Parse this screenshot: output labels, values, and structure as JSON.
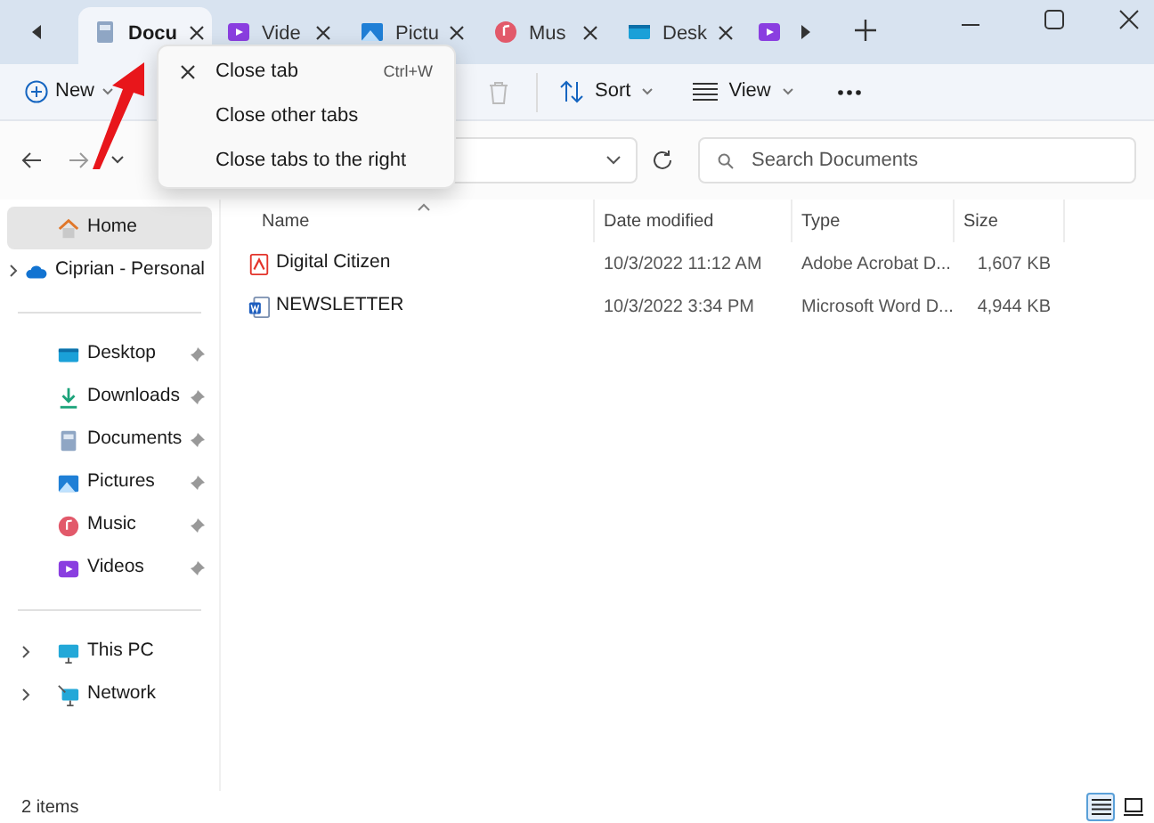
{
  "tabs": [
    {
      "label": "Docu",
      "kind": "documents",
      "selected": true
    },
    {
      "label": "Vide",
      "kind": "videos",
      "selected": false
    },
    {
      "label": "Pictu",
      "kind": "pictures",
      "selected": false
    },
    {
      "label": "Mus",
      "kind": "music",
      "selected": false
    },
    {
      "label": "Desk",
      "kind": "desktop",
      "selected": false
    },
    {
      "kind": "videos",
      "selected": false
    }
  ],
  "context_menu": [
    {
      "label": "Close tab",
      "shortcut": "Ctrl+W",
      "kind": "close"
    },
    {
      "label": "Close other tabs",
      "kind": "plain"
    },
    {
      "label": "Close tabs to the right",
      "kind": "plain"
    }
  ],
  "toolbar": {
    "new_button": "New",
    "sort_button": "Sort",
    "view_button": "View"
  },
  "search": {
    "placeholder": "Search Documents"
  },
  "sidebar": {
    "groups": [
      [
        {
          "label": "Home",
          "kind": "home",
          "selected": true,
          "expandable": false,
          "pinned": false
        },
        {
          "label": "Ciprian - Personal",
          "kind": "cloud",
          "selected": false,
          "expandable": true,
          "pinned": false
        }
      ],
      [
        {
          "label": "Desktop",
          "kind": "desktop",
          "selected": false,
          "expandable": false,
          "pinned": true
        },
        {
          "label": "Downloads",
          "kind": "downloads",
          "selected": false,
          "expandable": false,
          "pinned": true
        },
        {
          "label": "Documents",
          "kind": "documents",
          "selected": false,
          "expandable": false,
          "pinned": true
        },
        {
          "label": "Pictures",
          "kind": "pictures",
          "selected": false,
          "expandable": false,
          "pinned": true
        },
        {
          "label": "Music",
          "kind": "music",
          "selected": false,
          "expandable": false,
          "pinned": true
        },
        {
          "label": "Videos",
          "kind": "videos",
          "selected": false,
          "expandable": false,
          "pinned": true
        }
      ],
      [
        {
          "label": "This PC",
          "kind": "pc",
          "selected": false,
          "expandable": true,
          "pinned": false
        },
        {
          "label": "Network",
          "kind": "network",
          "selected": false,
          "expandable": true,
          "pinned": false
        }
      ]
    ]
  },
  "table": {
    "columns": [
      "Name",
      "Date modified",
      "Type",
      "Size"
    ],
    "rows": [
      {
        "kind": "pdf",
        "name": "Digital Citizen",
        "date": "10/3/2022 11:12 AM",
        "type": "Adobe Acrobat D...",
        "size": "1,607 KB",
        "selected": false
      },
      {
        "kind": "word",
        "name": "NEWSLETTER",
        "date": "10/3/2022 3:34 PM",
        "type": "Microsoft Word D...",
        "size": "4,944 KB",
        "selected": false
      }
    ]
  },
  "status_bar": {
    "text": "2 items",
    "views": [
      {
        "kind": "details",
        "selected": true
      },
      {
        "kind": "tiles",
        "selected": false
      }
    ]
  }
}
